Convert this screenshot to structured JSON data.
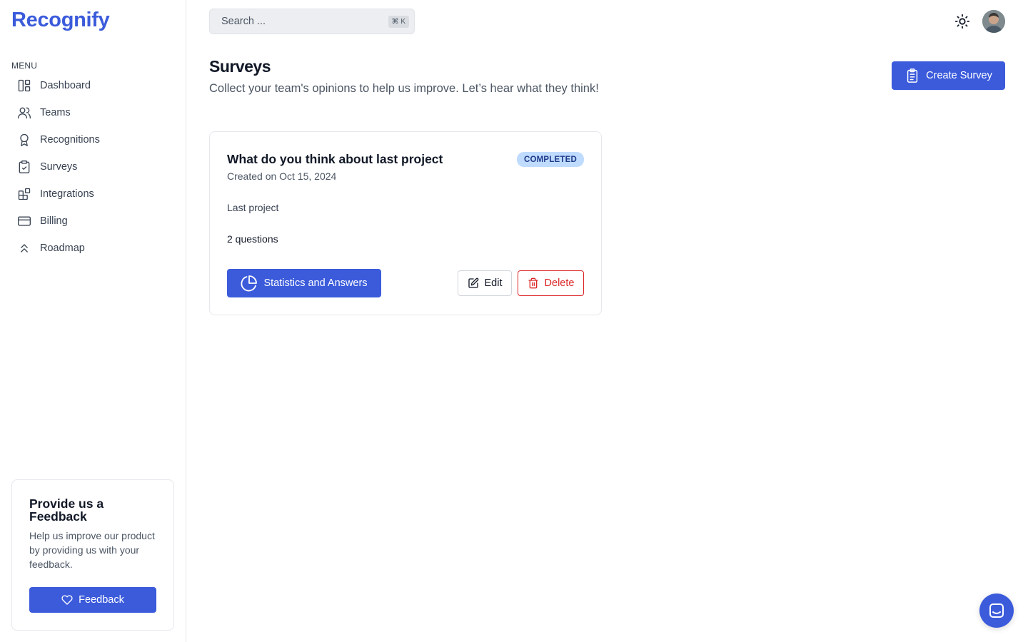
{
  "brand": {
    "logo_text": "Recognify",
    "accent_color": "#3b5bdb"
  },
  "sidebar": {
    "menu_label": "MENU",
    "items": [
      {
        "label": "Dashboard",
        "icon": "layout-dashboard-icon"
      },
      {
        "label": "Teams",
        "icon": "users-icon"
      },
      {
        "label": "Recognitions",
        "icon": "award-icon"
      },
      {
        "label": "Surveys",
        "icon": "clipboard-check-icon"
      },
      {
        "label": "Integrations",
        "icon": "blocks-icon"
      },
      {
        "label": "Billing",
        "icon": "credit-card-icon"
      },
      {
        "label": "Roadmap",
        "icon": "chevrons-up-icon"
      }
    ],
    "feedback": {
      "title": "Provide us a Feedback",
      "text": "Help us improve our product by providing us with your feedback.",
      "button_label": "Feedback",
      "button_icon": "heart-icon"
    }
  },
  "header": {
    "search": {
      "placeholder": "Search ...",
      "shortcut": "⌘ K"
    },
    "theme_toggle_icon": "sun-icon",
    "avatar_icon": "user-avatar"
  },
  "main": {
    "title": "Surveys",
    "subtitle": "Collect your team's opinions to help us improve. Let’s hear what they think!",
    "create_button": {
      "label": "Create Survey",
      "icon": "clipboard-list-icon"
    },
    "surveys": [
      {
        "title": "What do you think about last project",
        "created": "Created on Oct 15, 2024",
        "status": "COMPLETED",
        "status_color": "#bfdbfe",
        "description": "Last project",
        "question_count": "2 questions",
        "stats_button": "Statistics and Answers",
        "edit_button": "Edit",
        "delete_button": "Delete",
        "delete_color": "#dc2626"
      }
    ]
  },
  "chat_launcher_icon": "chat-icon"
}
